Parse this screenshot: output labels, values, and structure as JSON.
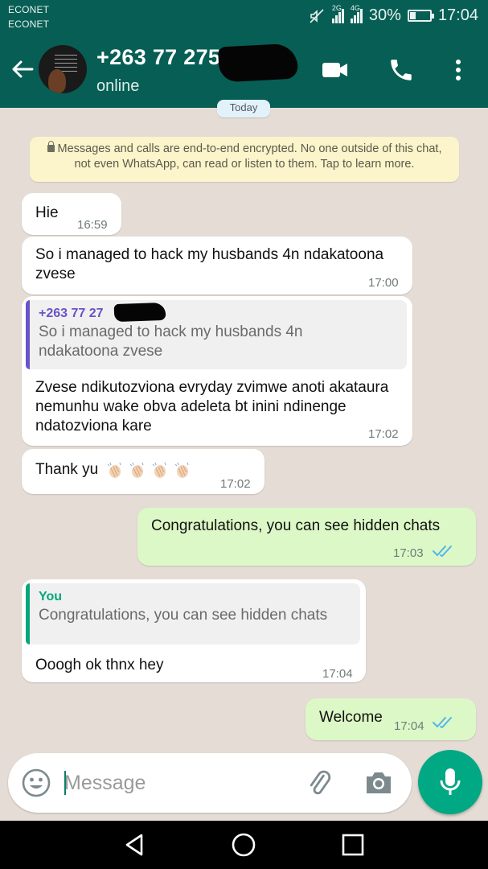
{
  "status_bar": {
    "carrier_1": "ECONET",
    "carrier_2": "ECONET",
    "network_1": "2G",
    "network_2": "4G",
    "battery": "30%",
    "battery_level": 0.3,
    "time": "17:04"
  },
  "header": {
    "contact": "+263 77 275",
    "status": "online"
  },
  "chat": {
    "day_chip": "Today",
    "encryption_notice": "Messages and calls are end-to-end encrypted. No one outside of this chat, not even WhatsApp, can read or listen to them. Tap to learn more.",
    "messages": [
      {
        "direction": "in",
        "text": "Hie",
        "time": "16:59"
      },
      {
        "direction": "in",
        "text": "So i managed to hack my husbands 4n ndakatoona zvese",
        "time": "17:00"
      },
      {
        "direction": "in",
        "quote_author": "+263 77 27",
        "quote_text": "So i managed to hack my husbands 4n ndakatoona zvese",
        "text": "Zvese ndikutozviona evryday zvimwe anoti akataura nemunhu wake obva adeleta bt inini ndinenge ndatozviona kare",
        "time": "17:02"
      },
      {
        "direction": "in",
        "text": "Thank yu",
        "emoji": "clapping-hands",
        "time": "17:02"
      },
      {
        "direction": "out",
        "text": "Congratulations, you can see hidden chats",
        "time": "17:03",
        "read": true
      },
      {
        "direction": "in",
        "quote_author": "You",
        "quote_text": "Congratulations, you can see hidden chats",
        "text": "Ooogh ok thnx hey",
        "time": "17:04"
      },
      {
        "direction": "out",
        "text": "Welcome",
        "time": "17:04",
        "read": true
      }
    ]
  },
  "composer": {
    "placeholder": "Message"
  },
  "colors": {
    "header": "#075e54",
    "outgoing_bubble": "#dcf8c6",
    "incoming_bubble": "#ffffff",
    "accent": "#00a884",
    "read_ticks": "#4fb6ec"
  }
}
